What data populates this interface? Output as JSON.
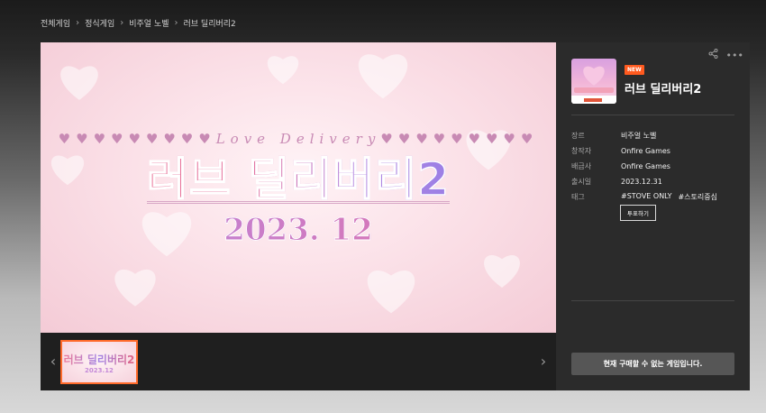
{
  "breadcrumb": [
    "전체게임",
    "정식게임",
    "비주얼 노벨",
    "러브 딜리버리2"
  ],
  "hero": {
    "subtitle": "♥♥♥♥♥♥♥♥♥Love Delivery♥♥♥♥♥♥♥♥♥",
    "title": "러브 딜리버리2",
    "date": "2023. 12"
  },
  "thumbnail": {
    "title": "러브 딜리버리2",
    "date": "2023.12"
  },
  "panel": {
    "badge": "NEW",
    "game_title": "러브 딜리버리2",
    "info": [
      {
        "key": "장르",
        "value": "비주얼 노벨"
      },
      {
        "key": "창작자",
        "value": "Onfire Games"
      },
      {
        "key": "배급사",
        "value": "Onfire Games"
      },
      {
        "key": "출시일",
        "value": "2023.12.31"
      }
    ],
    "tags_label": "태그",
    "tags": [
      "#STOVE ONLY",
      "#스토리중심"
    ],
    "vote_button": "투표하기",
    "buy_button": "현재 구매할 수 없는 게임입니다."
  },
  "colors": {
    "accent_orange": "#ff5a1f",
    "panel_bg": "#2b2b2b",
    "hero_pink": "#fbe1e8"
  },
  "icons": [
    "share-icon",
    "more-icon",
    "chevron-left-icon",
    "chevron-right-icon",
    "chevron-right-icon"
  ]
}
